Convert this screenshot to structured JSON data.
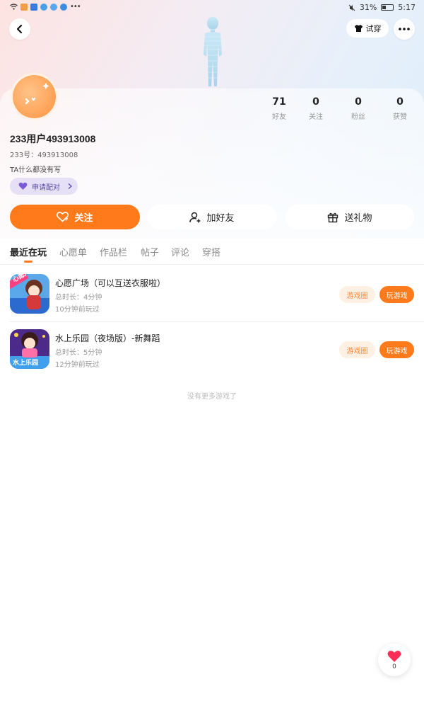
{
  "status_bar": {
    "battery": "31%",
    "time": "5:17"
  },
  "header": {
    "tryon_label": "试穿"
  },
  "profile": {
    "stats": [
      {
        "value": "71",
        "label": "好友"
      },
      {
        "value": "0",
        "label": "关注"
      },
      {
        "value": "0",
        "label": "粉丝"
      },
      {
        "value": "0",
        "label": "获赞"
      }
    ],
    "username": "233用户493913008",
    "uid": "233号：493913008",
    "bio": "TA什么都没有写",
    "pair_label": "申请配对"
  },
  "actions": {
    "follow": "关注",
    "add_friend": "加好友",
    "gift": "送礼物"
  },
  "tabs": [
    "最近在玩",
    "心愿单",
    "作品栏",
    "帖子",
    "评论",
    "穿搭"
  ],
  "games": [
    {
      "title": "心愿广场（可以互送衣服啦）",
      "duration": "总时长：4分钟",
      "last_played": "10分钟前玩过",
      "circle_label": "游戏圈",
      "play_label": "玩游戏",
      "icon_text": "心愿广"
    },
    {
      "title": "水上乐园（夜场版）-新舞蹈",
      "duration": "总时长：5分钟",
      "last_played": "12分钟前玩过",
      "circle_label": "游戏圈",
      "play_label": "玩游戏",
      "icon_text": "水上乐园"
    }
  ],
  "no_more_text": "没有更多游戏了",
  "like": {
    "count": "0"
  },
  "colors": {
    "accent": "#ff7a1a",
    "pair_bg": "#e6e0f7"
  }
}
